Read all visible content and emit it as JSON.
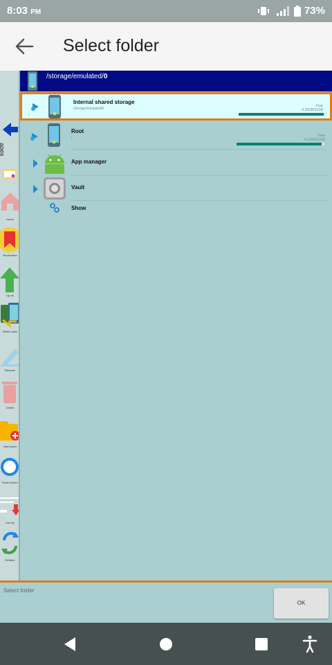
{
  "status": {
    "time": "8:03",
    "ampm": "PM",
    "battery": "73%"
  },
  "appbar": {
    "title": "Select folder"
  },
  "sidebar": {
    "apex": "apex",
    "items": [
      {
        "label": "Home",
        "icon": "home-icon"
      },
      {
        "label": "Bookmarks",
        "icon": "bookmark-icon"
      },
      {
        "label": "Up dir",
        "icon": "up-arrow-icon"
      },
      {
        "label": "Switch pane",
        "icon": "switch-pane-icon"
      },
      {
        "label": "Rename",
        "icon": "pencil-icon"
      },
      {
        "label": "Delete",
        "icon": "trash-icon"
      },
      {
        "label": "New folder",
        "icon": "new-folder-icon"
      },
      {
        "label": "Show hidden",
        "icon": "eye-icon"
      },
      {
        "label": "Sort by",
        "icon": "sort-icon"
      },
      {
        "label": "Refresh",
        "icon": "refresh-icon"
      }
    ]
  },
  "path": {
    "prefix": "/storage/emulated/",
    "last": "0"
  },
  "rows": [
    {
      "name": "Internal shared storage",
      "path": "/storage/emulated/0",
      "free_label": "Free",
      "free_value": "4.20GB/11GB",
      "usage": 0.97
    },
    {
      "name": "Root",
      "path": "/",
      "free_label": "Free",
      "free_value": "4.13GB/11GB",
      "usage": 0.97
    },
    {
      "name": "App manager"
    },
    {
      "name": "Vault"
    },
    {
      "name": "Show"
    }
  ],
  "bottom": {
    "label": "Select folder",
    "ok": "OK"
  },
  "colors": {
    "accent": "#e27a14",
    "header": "#020a84",
    "background": "#a9cfd0",
    "usage_fill": "#0d7f72"
  }
}
